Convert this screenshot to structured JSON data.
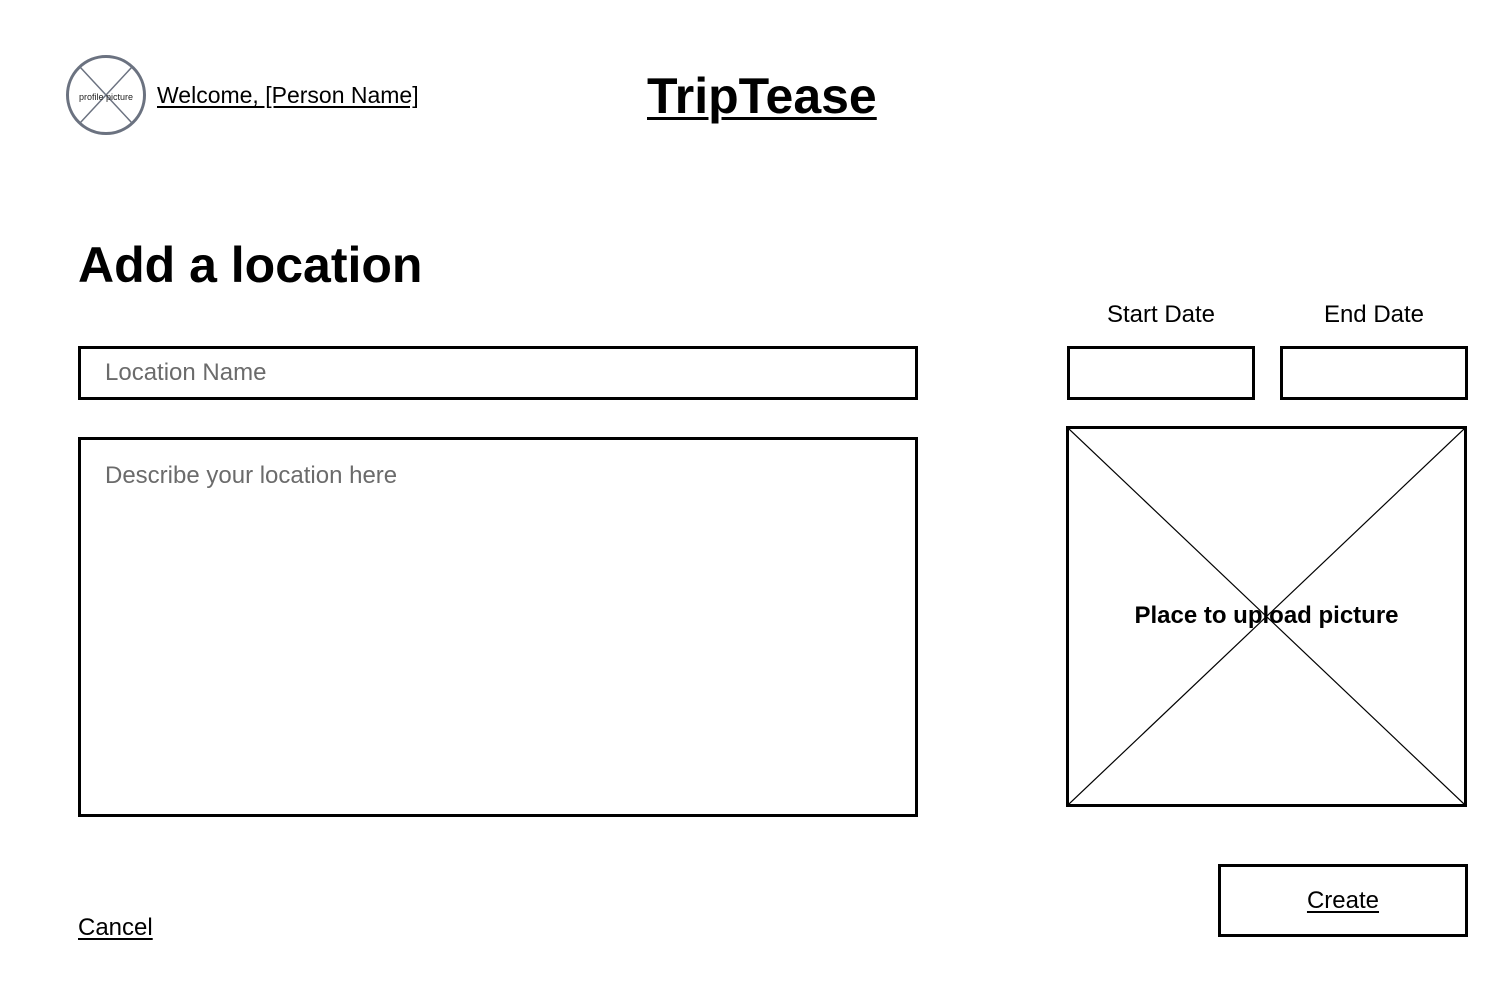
{
  "header": {
    "avatar_label": "profile picture",
    "welcome_text": "Welcome, [Person Name]",
    "brand": "TripTease"
  },
  "main": {
    "title": "Add a location",
    "location_name_placeholder": "Location Name",
    "description_placeholder": "Describe your location here",
    "start_date_label": "Start Date",
    "end_date_label": "End Date",
    "upload_label": "Place to upload picture"
  },
  "actions": {
    "create_label": "Create",
    "cancel_label": "Cancel"
  },
  "icons": {
    "avatar": "placeholder-x-circle-icon",
    "upload": "placeholder-x-image-icon"
  }
}
